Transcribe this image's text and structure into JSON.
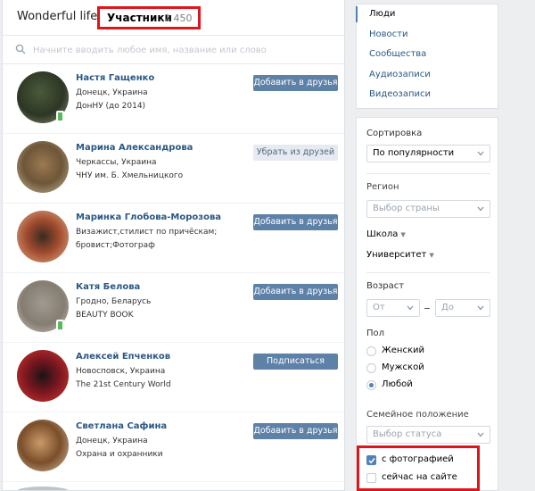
{
  "header": {
    "group_name": "Wonderful life))",
    "members_tab": "Участники",
    "members_count": "2 450"
  },
  "search": {
    "placeholder": "Начните вводить любое имя, название или слово"
  },
  "people": [
    {
      "name": "Настя Гащенко",
      "line1": "Донецк, Украина",
      "line2": "ДонНУ (до 2014)",
      "action": "Добавить в друзья",
      "mobile": true
    },
    {
      "name": "Марина Александрова",
      "line1": "Черкассы, Украина",
      "line2": "ЧНУ им. Б. Хмельницкого",
      "action": "Убрать из друзей",
      "mobile": false
    },
    {
      "name": "Маринка Глобова-Морозова",
      "line1": "Визажист,стилист по причёскам;",
      "line2": "бровист;Фотограф",
      "action": "Добавить в друзья",
      "mobile": false
    },
    {
      "name": "Катя Белова",
      "line1": "Гродно, Беларусь",
      "line2": "BEAUTY BOOK",
      "action": "Добавить в друзья",
      "mobile": true
    },
    {
      "name": "Алексей Епченков",
      "line1": "Новосповск, Украина",
      "line2": "The 21st Century World",
      "action": "Подписаться",
      "mobile": false
    },
    {
      "name": "Светлана Сафина",
      "line1": "Донецк, Украина",
      "line2": "Охрана и охранники",
      "action": "Добавить в друзья",
      "mobile": false
    }
  ],
  "nav": [
    "Люди",
    "Новости",
    "Сообщества",
    "Аудиозаписи",
    "Видеозаписи"
  ],
  "filters": {
    "sort_label": "Сортировка",
    "sort_value": "По популярности",
    "region_label": "Регион",
    "region_value": "Выбор страны",
    "school_label": "Школа",
    "university_label": "Университет",
    "age_label": "Возраст",
    "age_from": "От",
    "age_to": "До",
    "gender_label": "Пол",
    "gender_options": [
      "Женский",
      "Мужской",
      "Любой"
    ],
    "marital_label": "Семейное положение",
    "marital_value": "Выбор статуса",
    "with_photo": "с фотографией",
    "online_now": "сейчас на сайте"
  },
  "colors": {
    "accent": "#5181b8",
    "link": "#2a5885",
    "highlight": "#e0141b",
    "online": "#5bb85d"
  },
  "icons": {
    "search": "search-icon",
    "chevron": "chevron-down-icon",
    "mobile": "mobile-online-icon",
    "check": "check-icon"
  }
}
